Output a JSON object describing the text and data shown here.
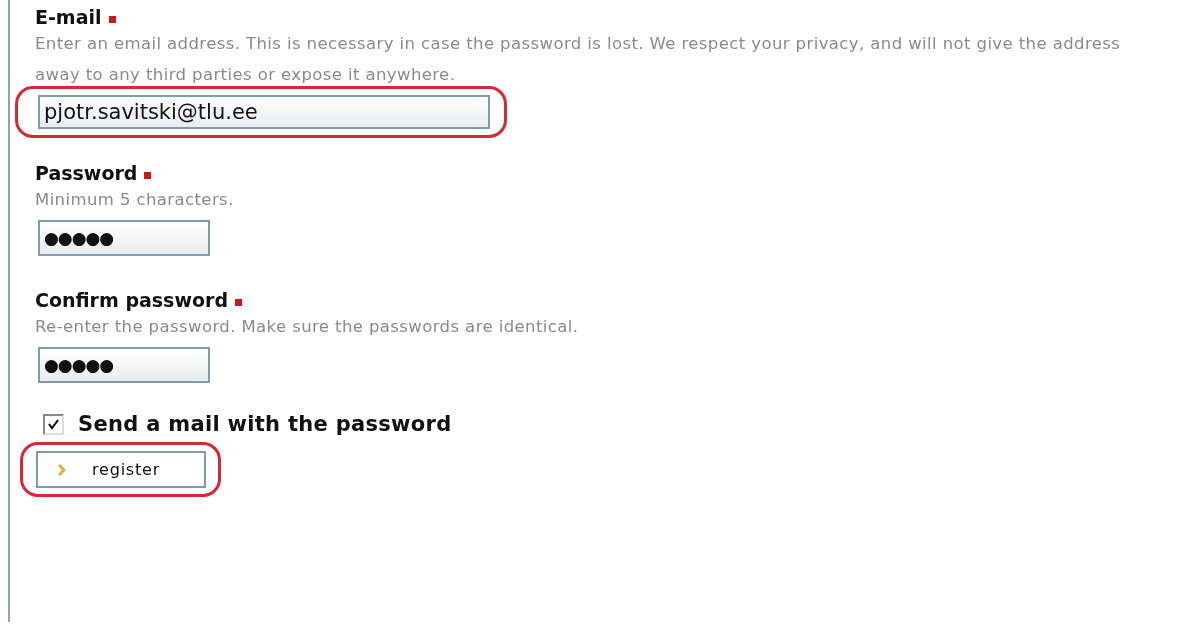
{
  "fields": [
    {
      "kind": "text",
      "label": "E-mail",
      "required": true,
      "hint": "Enter an email address. This is necessary in case the password is lost. We respect your privacy, and will not give the address away to any third parties or expose it anywhere.",
      "value": "pjotr.savitski@tlu.ee",
      "highlighted": true
    },
    {
      "kind": "password",
      "label": "Password",
      "required": true,
      "hint": "Minimum 5 characters.",
      "value": "●●●●●",
      "highlighted": false
    },
    {
      "kind": "password",
      "label": "Confirm password",
      "required": true,
      "hint": "Re-enter the password. Make sure the passwords are identical.",
      "value": "●●●●●",
      "highlighted": false
    }
  ],
  "send_mail": {
    "label": "Send a mail with the password",
    "checked": true
  },
  "submit": {
    "label": "register",
    "highlighted": true
  }
}
